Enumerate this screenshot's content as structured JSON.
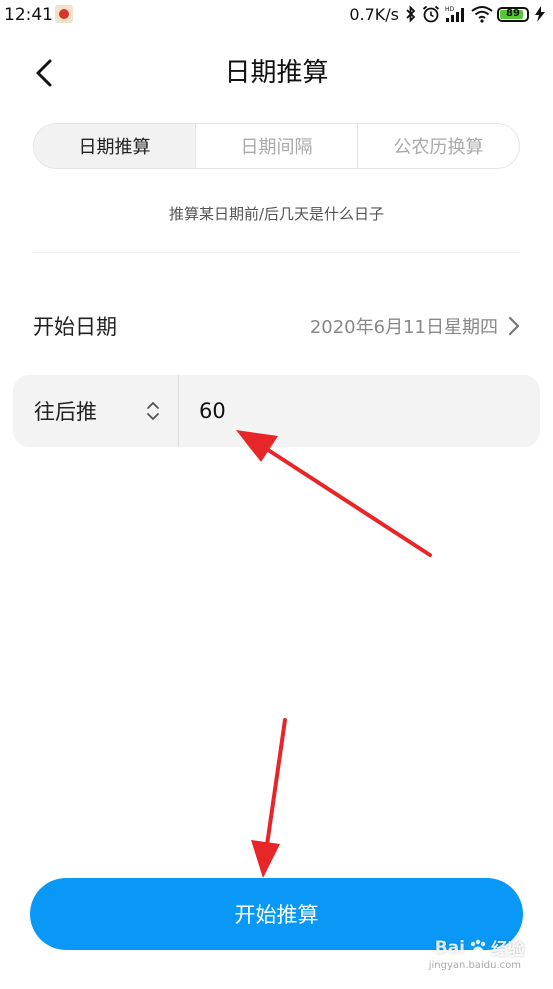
{
  "status_bar": {
    "time": "12:41",
    "network_speed": "0.7K/s",
    "battery_level": "89",
    "battery_fraction": 0.89,
    "icons": [
      "app-notification-icon",
      "bluetooth-icon",
      "alarm-icon",
      "hd-signal-icon",
      "wifi-icon",
      "battery-icon",
      "charging-icon"
    ]
  },
  "header": {
    "title": "日期推算",
    "back_icon": "chevron-left-icon"
  },
  "tabs": [
    {
      "label": "日期推算",
      "active": true
    },
    {
      "label": "日期间隔",
      "active": false
    },
    {
      "label": "公农历换算",
      "active": false
    }
  ],
  "subtitle": "推算某日期前/后几天是什么日子",
  "start_date": {
    "label": "开始日期",
    "value": "2020年6月11日星期四",
    "icon": "chevron-right-icon"
  },
  "offset": {
    "direction": "往后推",
    "direction_icon": "up-down-arrows-icon",
    "days_value": "60"
  },
  "primary_button": {
    "label": "开始推算"
  },
  "watermark": {
    "text": "Bai",
    "text2": "经验",
    "sub": "jingyan.baidu.com",
    "icon": "paw-icon"
  },
  "colors": {
    "accent": "#0a98f7",
    "annotation_arrow": "#e8262a",
    "battery": "#55c832"
  }
}
